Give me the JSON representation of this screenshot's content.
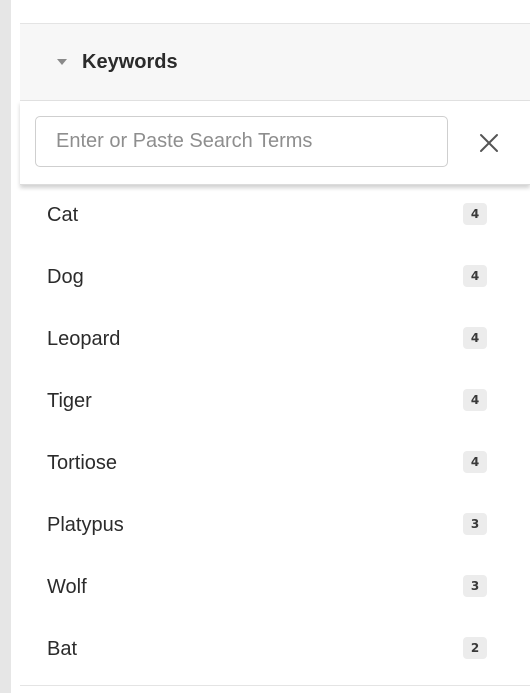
{
  "keywords_section": {
    "title": "Keywords",
    "search": {
      "placeholder": "Enter or Paste Search Terms",
      "value": "",
      "clear_icon": "close-icon"
    },
    "items": [
      {
        "label": "Cat",
        "count": "4"
      },
      {
        "label": "Dog",
        "count": "4"
      },
      {
        "label": "Leopard",
        "count": "4"
      },
      {
        "label": "Tiger",
        "count": "4"
      },
      {
        "label": "Tortiose",
        "count": "4"
      },
      {
        "label": "Platypus",
        "count": "3"
      },
      {
        "label": "Wolf",
        "count": "3"
      },
      {
        "label": "Bat",
        "count": "2"
      }
    ]
  },
  "colors": {
    "header_background": "#f7f7f7",
    "badge_background": "#ececec",
    "text": "#2b2b2b"
  }
}
